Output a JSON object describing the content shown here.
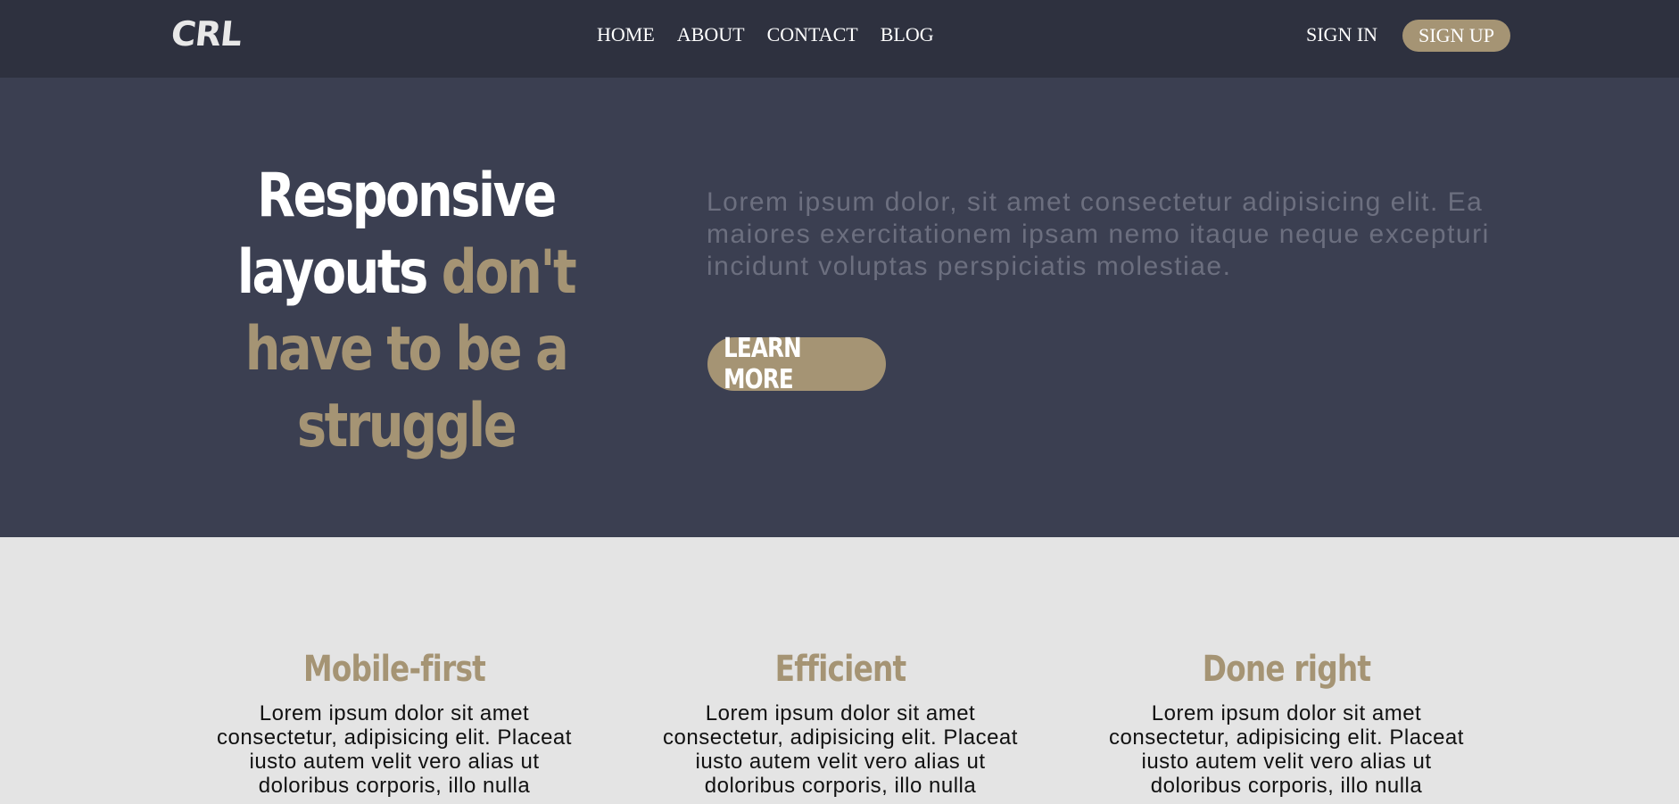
{
  "header": {
    "logo": "CRL",
    "nav": [
      "HOME",
      "ABOUT",
      "CONTACT",
      "BLOG"
    ],
    "sign_in": "SIGN IN",
    "sign_up": "SIGN UP"
  },
  "hero": {
    "title_white_1": "Responsive",
    "title_white_2": "layouts ",
    "title_gold_1": "don't",
    "title_gold_2": "have to be a",
    "title_gold_3": "struggle",
    "text": "Lorem ipsum dolor, sit amet consectetur adipisicing elit. Ea maiores exercitationem ipsam nemo itaque neque excepturi incidunt voluptas perspiciatis molestiae.",
    "button": "LEARN MORE"
  },
  "features": [
    {
      "title": "Mobile-first",
      "text": "Lorem ipsum dolor sit amet consectetur, adipisicing elit. Placeat iusto autem velit vero alias ut doloribus corporis, illo nulla"
    },
    {
      "title": "Efficient",
      "text": "Lorem ipsum dolor sit amet consectetur, adipisicing elit. Placeat iusto autem velit vero alias ut doloribus corporis, illo nulla"
    },
    {
      "title": "Done right",
      "text": "Lorem ipsum dolor sit amet consectetur, adipisicing elit. Placeat iusto autem velit vero alias ut doloribus corporis, illo nulla"
    }
  ],
  "colors": {
    "header_bg": "#2e313f",
    "hero_bg": "#3b3f51",
    "accent": "#a59474",
    "section_bg": "#e4e4e4"
  }
}
